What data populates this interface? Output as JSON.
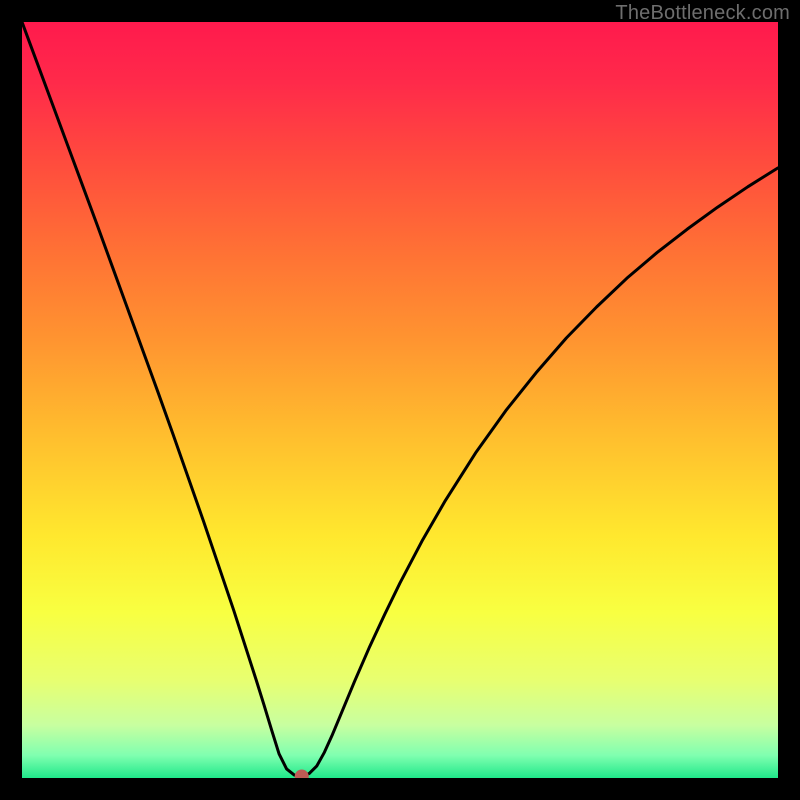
{
  "watermark": "TheBottleneck.com",
  "gradient": {
    "stops": [
      {
        "offset": 0.0,
        "color": "#ff1a4d"
      },
      {
        "offset": 0.08,
        "color": "#ff2a4a"
      },
      {
        "offset": 0.18,
        "color": "#ff4a3e"
      },
      {
        "offset": 0.3,
        "color": "#ff7035"
      },
      {
        "offset": 0.42,
        "color": "#ff9430"
      },
      {
        "offset": 0.55,
        "color": "#ffbf2e"
      },
      {
        "offset": 0.68,
        "color": "#ffe82e"
      },
      {
        "offset": 0.78,
        "color": "#f8ff41"
      },
      {
        "offset": 0.87,
        "color": "#e8ff70"
      },
      {
        "offset": 0.93,
        "color": "#c8ffa0"
      },
      {
        "offset": 0.97,
        "color": "#80ffb0"
      },
      {
        "offset": 1.0,
        "color": "#20e88a"
      }
    ]
  },
  "chart_data": {
    "type": "line",
    "title": "",
    "xlabel": "",
    "ylabel": "",
    "xlim": [
      0,
      100
    ],
    "ylim": [
      0,
      100
    ],
    "series": [
      {
        "name": "curve",
        "x": [
          0,
          2,
          4,
          6,
          8,
          10,
          12,
          14,
          16,
          18,
          20,
          22,
          24,
          26,
          28,
          30,
          31,
          32,
          33,
          34,
          35,
          36,
          37,
          38,
          39,
          40,
          41,
          42,
          44,
          46,
          48,
          50,
          53,
          56,
          60,
          64,
          68,
          72,
          76,
          80,
          84,
          88,
          92,
          96,
          100
        ],
        "y": [
          100,
          94.6,
          89.2,
          83.8,
          78.4,
          73.0,
          67.5,
          62.0,
          56.5,
          51.0,
          45.4,
          39.7,
          34.0,
          28.1,
          22.2,
          16.0,
          12.9,
          9.7,
          6.4,
          3.2,
          1.2,
          0.4,
          0.2,
          0.6,
          1.6,
          3.4,
          5.6,
          8.0,
          12.8,
          17.4,
          21.7,
          25.8,
          31.5,
          36.7,
          43.0,
          48.6,
          53.6,
          58.2,
          62.3,
          66.1,
          69.5,
          72.6,
          75.5,
          78.2,
          80.7
        ]
      }
    ],
    "marker": {
      "x": 37,
      "y": 0.2,
      "color": "#be5b55",
      "radius_px": 7
    }
  }
}
